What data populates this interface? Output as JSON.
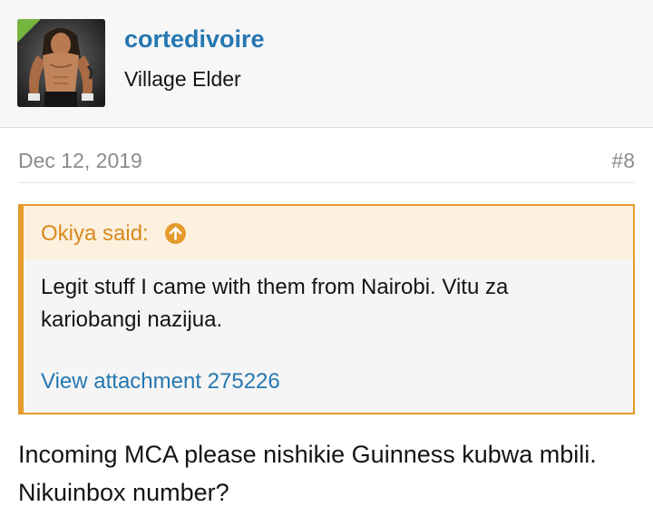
{
  "user": {
    "name": "cortedivoire",
    "title": "Village Elder"
  },
  "post": {
    "date": "Dec 12, 2019",
    "number": "#8"
  },
  "quote": {
    "author_line": "Okiya said:",
    "text": "Legit stuff I came with them from Nairobi. Vitu za kariobangi nazijua.",
    "attachment": "View attachment 275226"
  },
  "message": "Incoming MCA please nishikie Guinness kubwa mbili. Nikuinbox number?",
  "colors": {
    "link": "#2577b1",
    "quote_accent": "#e59a2d",
    "quote_header_bg": "#fdf0de",
    "badge": "#75b640"
  },
  "icons": {
    "quote_jump": "arrow-up-circle-icon"
  }
}
